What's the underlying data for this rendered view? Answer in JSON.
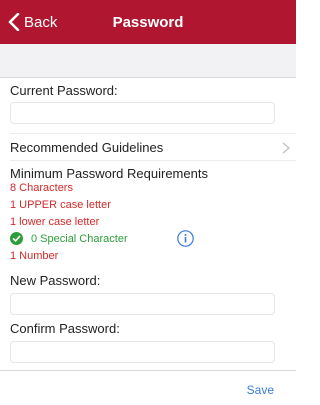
{
  "nav": {
    "back_label": "Back",
    "title": "Password"
  },
  "form": {
    "current_password_label": "Current Password:",
    "recommended_guidelines": "Recommended Guidelines",
    "requirements_title": "Minimum Password Requirements",
    "requirements": {
      "chars": "8 Characters",
      "upper": "1 UPPER case letter",
      "lower": "1 lower case letter",
      "special": "0 Special Character",
      "number": "1 Number"
    },
    "new_password_label": "New Password:",
    "confirm_password_label": "Confirm Password:"
  },
  "footer": {
    "save_label": "Save"
  },
  "colors": {
    "brand": "#b0162f",
    "error": "#d12a2a",
    "success": "#2e9e3c",
    "link": "#3a7bd5"
  }
}
